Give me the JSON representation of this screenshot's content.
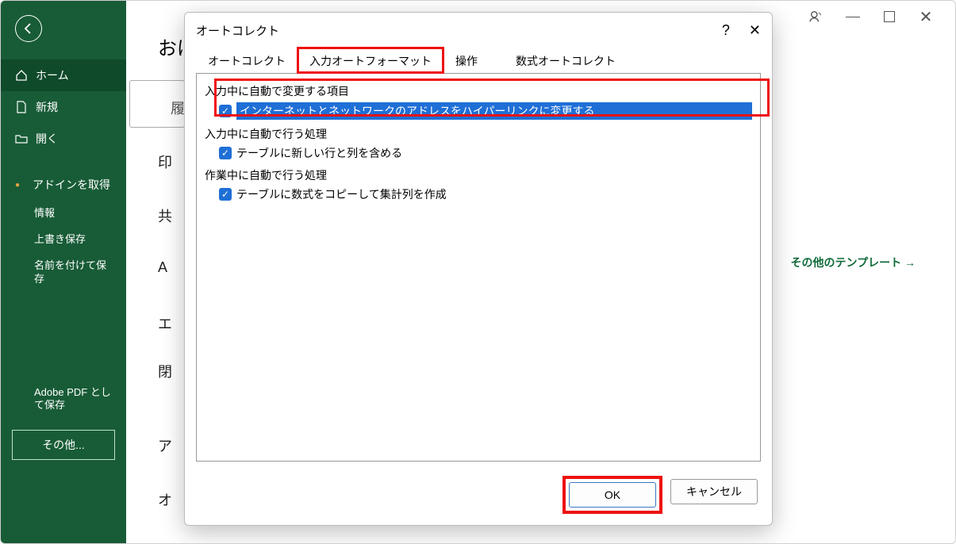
{
  "titlebar": {
    "account_icon": "account",
    "min": "—",
    "max": "□",
    "close": "✕"
  },
  "sidebar": {
    "home": "ホーム",
    "new": "新規",
    "open": "開く",
    "get_addins": "アドインを取得",
    "info": "情報",
    "save": "上書き保存",
    "save_as": "名前を付けて保存",
    "adobe": "Adobe PDF として保存",
    "other": "その他..."
  },
  "bg": {
    "greeting": "おは",
    "row1": "履",
    "row2": "印",
    "row3": "共",
    "row4": "A",
    "row5": "エ",
    "row6": "閉",
    "row7": "ア",
    "row8": "オ",
    "more_templates": "その他のテンプレート  →"
  },
  "dialog": {
    "title": "オートコレクト",
    "tabs": {
      "t1": "オートコレクト",
      "t2": "入力オートフォーマット",
      "t3": "操作",
      "t4": "数式オートコレクト"
    },
    "groups": {
      "g1": "入力中に自動で変更する項目",
      "g2": "入力中に自動で行う処理",
      "g3": "作業中に自動で行う処理"
    },
    "opts": {
      "hyperlink": "インターネットとネットワークのアドレスをハイパーリンクに変更する",
      "table_rows": "テーブルに新しい行と列を含める",
      "table_formula": "テーブルに数式をコピーして集計列を作成"
    },
    "ok": "OK",
    "cancel": "キャンセル"
  }
}
